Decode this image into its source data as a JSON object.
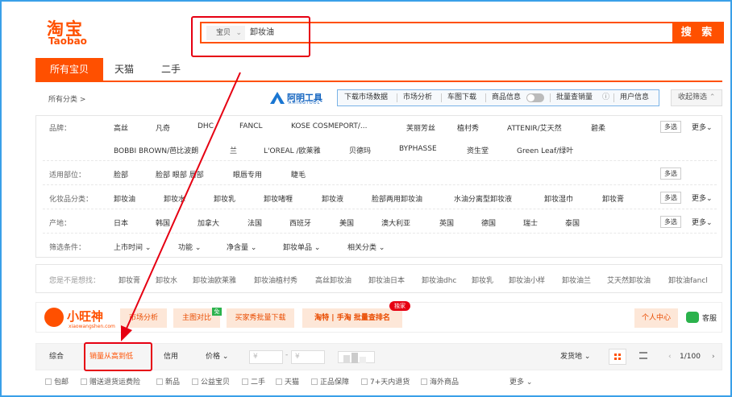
{
  "logo": {
    "cn": "淘宝",
    "en": "Taobao"
  },
  "search": {
    "category": "宝贝",
    "query": "卸妆油",
    "button": "搜 索"
  },
  "tabs": [
    "所有宝贝",
    "天猫",
    "二手"
  ],
  "breadcrumb": "所有分类 >",
  "plugin": {
    "logo_text": "阿明工具",
    "logo_sub": "AMINGTOOL",
    "tools": [
      "下载市场数据",
      "市场分析",
      "车图下载",
      "商品信息",
      "批量查销量",
      "用户信息"
    ],
    "collapse": "收起筛选"
  },
  "filters": {
    "brand_label": "品牌：",
    "brand_row1": [
      "高丝",
      "凡奇",
      "DHC",
      "FANCL",
      "KOSE COSMEPORT/...",
      "芙丽芳丝",
      "植村秀",
      "ATTENIR/艾天然",
      "碧柔"
    ],
    "brand_row2": [
      "BOBBI BROWN/芭比波朗",
      "兰",
      "L'OREAL /欧莱雅",
      "贝德玛",
      "BYPHASSE",
      "资生堂",
      "Green Leaf/绿叶"
    ],
    "area_label": "适用部位：",
    "area": [
      "脸部",
      "脸部 眼部 唇部",
      "眼唇专用",
      "睫毛"
    ],
    "type_label": "化妆品分类：",
    "type": [
      "卸妆油",
      "卸妆水",
      "卸妆乳",
      "卸妆啫喱",
      "卸妆液",
      "脸部两用卸妆油",
      "水油分离型卸妆液",
      "卸妆湿巾",
      "卸妆膏"
    ],
    "origin_label": "产地：",
    "origin": [
      "日本",
      "韩国",
      "加拿大",
      "法国",
      "西班牙",
      "美国",
      "澳大利亚",
      "英国",
      "德国",
      "瑞士",
      "泰国"
    ],
    "cond_label": "筛选条件：",
    "cond": [
      "上市时间",
      "功能",
      "净含量",
      "卸妆单品",
      "相关分类"
    ],
    "multi": "多选",
    "more": "更多"
  },
  "suggest": {
    "label": "您是不是想找：",
    "items": [
      "卸妆膏",
      "卸妆水",
      "卸妆油欧莱雅",
      "卸妆油植村秀",
      "高丝卸妆油",
      "卸妆油日本",
      "卸妆油dhc",
      "卸妆乳",
      "卸妆油小样",
      "卸妆油兰",
      "艾天然卸妆油",
      "卸妆油fancl"
    ]
  },
  "xiaowang": {
    "name": "小旺神",
    "url": "xiaowangshen.com",
    "buttons": [
      "市场分析",
      "主图对比",
      "买家秀批量下载",
      "淘特 | 手淘 批量查排名"
    ],
    "badge_free": "免",
    "badge_exclusive": "独家",
    "personal": "个人中心",
    "service": "客服"
  },
  "sort": {
    "items": [
      "综合",
      "销量从高到低",
      "信用",
      "价格"
    ],
    "price_from": "¥",
    "price_to": "¥",
    "ship": "发货地",
    "pager": "1/100"
  },
  "checks": [
    "包邮",
    "赠送退货运费险",
    "新品",
    "公益宝贝",
    "二手",
    "天猫",
    "正品保障",
    "7+天内退货",
    "海外商品"
  ],
  "checks_more": "更多",
  "colors": {
    "accent": "#ff5000",
    "annotation": "#e60012",
    "frame": "#3aa0e8"
  }
}
